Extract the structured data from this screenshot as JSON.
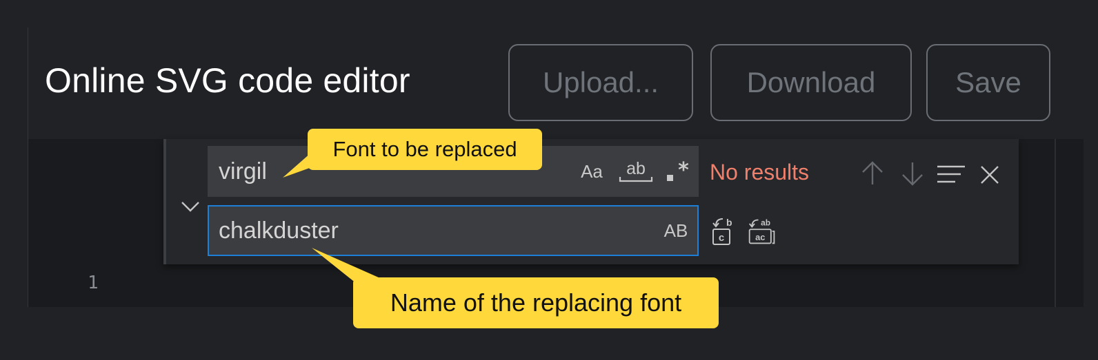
{
  "header": {
    "title": "Online SVG code editor",
    "buttons": {
      "upload": "Upload...",
      "download": "Download",
      "save": "Save"
    }
  },
  "editor": {
    "line_number": "1"
  },
  "find_widget": {
    "find_value": "virgil",
    "replace_value": "chalkduster",
    "options": {
      "match_case": "Aa",
      "whole_word": "ab",
      "regex": ".*",
      "preserve_case": "AB"
    },
    "status": "No results",
    "icons": [
      "chevron-down-icon",
      "arrow-up-icon",
      "arrow-down-icon",
      "find-in-selection-icon",
      "close-icon",
      "replace-icon",
      "replace-all-icon"
    ]
  },
  "callouts": {
    "find": "Font to be replaced",
    "replace": "Name of the replacing font"
  },
  "colors": {
    "background": "#202226",
    "accent_border": "#1e7fd6",
    "no_results": "#f0806b",
    "callout": "#ffd83b"
  }
}
